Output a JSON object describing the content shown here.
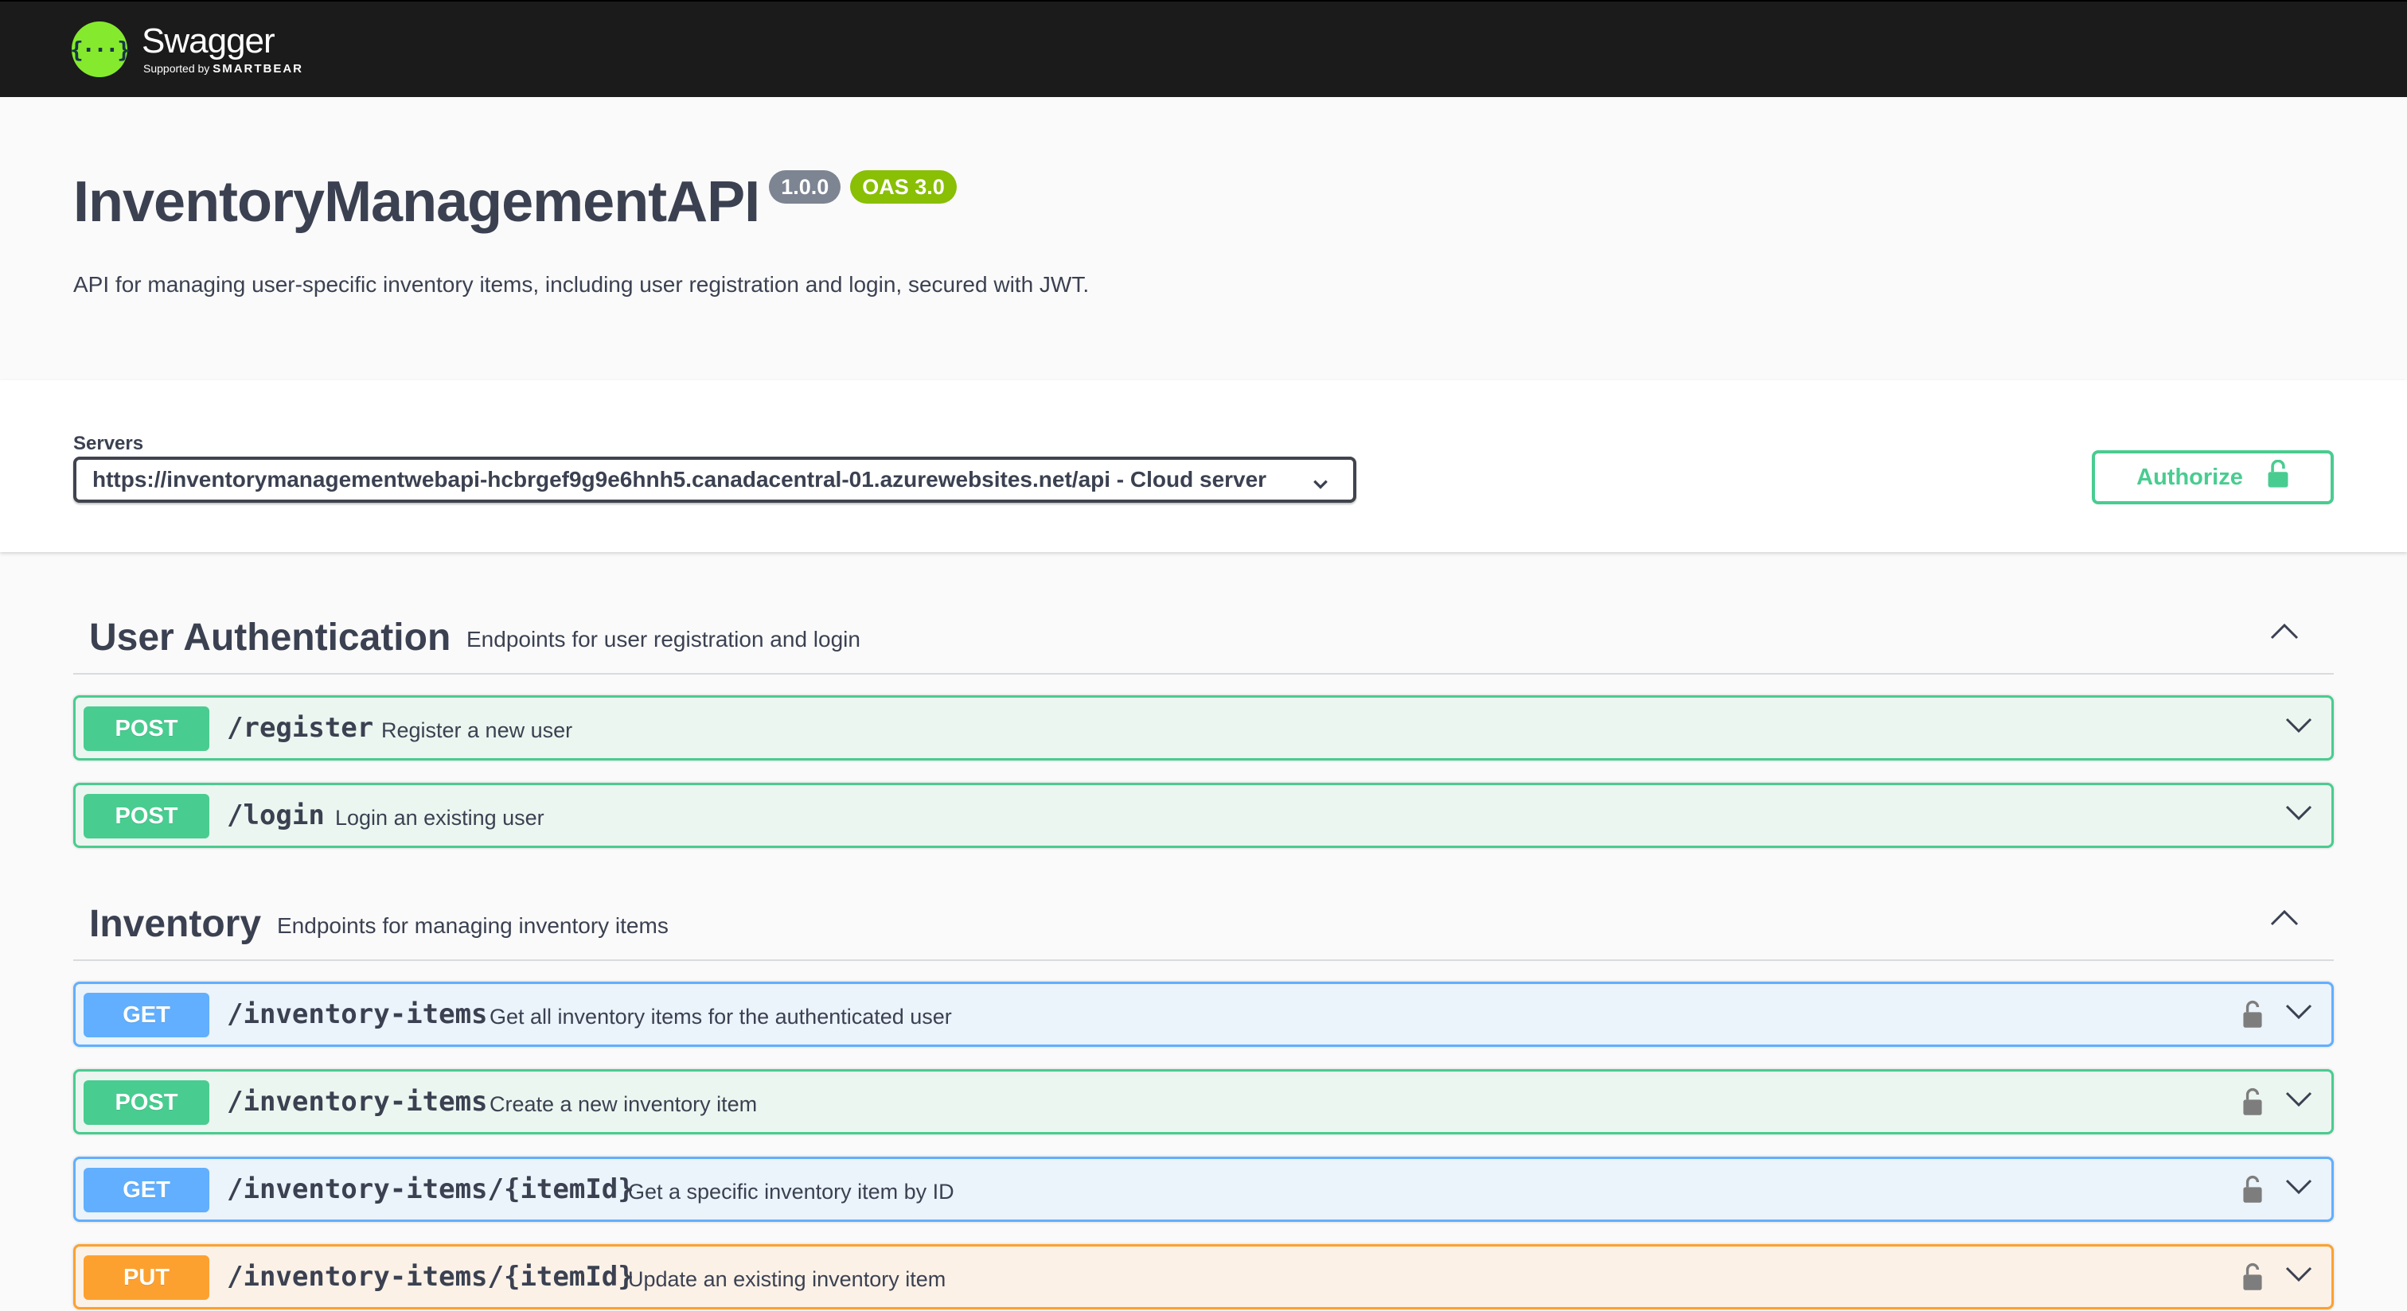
{
  "topbar": {
    "logo_name": "Swagger",
    "logo_supported_by": "Supported by",
    "logo_brand": "SMARTBEAR",
    "logo_glyph": "{···}",
    "logo_color": "#85ea2d"
  },
  "info": {
    "title": "InventoryManagementAPI",
    "version": "1.0.0",
    "oas": "OAS 3.0",
    "description": "API for managing user-specific inventory items, including user registration and login, secured with JWT."
  },
  "servers": {
    "label": "Servers",
    "selected": "https://inventorymanagementwebapi-hcbrgef9g9e6hnh5.canadacentral-01.azurewebsites.net/api - Cloud server"
  },
  "authorize": {
    "label": "Authorize",
    "icon": "lock-icon",
    "color": "#49cc90"
  },
  "tags": [
    {
      "name": "User Authentication",
      "description": "Endpoints for user registration and login",
      "operations": [
        {
          "method": "POST",
          "path": "/register",
          "summary": "Register a new user",
          "locked": false
        },
        {
          "method": "POST",
          "path": "/login",
          "summary": "Login an existing user",
          "locked": false
        }
      ]
    },
    {
      "name": "Inventory",
      "description": "Endpoints for managing inventory items",
      "operations": [
        {
          "method": "GET",
          "path": "/inventory-items",
          "summary": "Get all inventory items for the authenticated user",
          "locked": true
        },
        {
          "method": "POST",
          "path": "/inventory-items",
          "summary": "Create a new inventory item",
          "locked": true
        },
        {
          "method": "GET",
          "path": "/inventory-items/{itemId}",
          "summary": "Get a specific inventory item by ID",
          "locked": true
        },
        {
          "method": "PUT",
          "path": "/inventory-items/{itemId}",
          "summary": "Update an existing inventory item",
          "locked": true
        }
      ]
    }
  ],
  "colors": {
    "post": "#49cc90",
    "get": "#61affe",
    "put": "#fca130",
    "topbar_bg": "#1b1b1b"
  }
}
